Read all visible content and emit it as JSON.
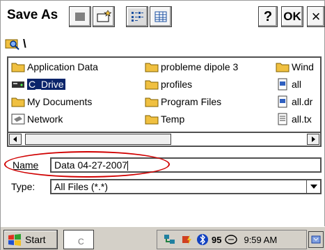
{
  "title": "Save As",
  "toolbar": {
    "help_label": "?",
    "ok_label": "OK",
    "close_label": "×"
  },
  "path": "\\",
  "files": [
    {
      "name": "Application Data",
      "icon": "folder-icon"
    },
    {
      "name": "C_Drive",
      "icon": "drive-icon",
      "selected": true
    },
    {
      "name": "My Documents",
      "icon": "folder-icon"
    },
    {
      "name": "Network",
      "icon": "network-icon"
    },
    {
      "name": "probleme dipole 3",
      "icon": "folder-icon"
    },
    {
      "name": "profiles",
      "icon": "folder-icon"
    },
    {
      "name": "Program Files",
      "icon": "folder-icon"
    },
    {
      "name": "Temp",
      "icon": "folder-icon"
    },
    {
      "name": "Wind",
      "icon": "folder-icon"
    },
    {
      "name": "all",
      "icon": "file-icon"
    },
    {
      "name": "all.dr",
      "icon": "file-icon"
    },
    {
      "name": "all.tx",
      "icon": "text-file-icon"
    }
  ],
  "name_field": {
    "label": "Name",
    "value": "Data 04-27-2007"
  },
  "type_field": {
    "label": "Type:",
    "value": "All Files (*.*)"
  },
  "taskbar": {
    "start_label": "Start",
    "task_label": "C",
    "tray_number": "95",
    "time": "9:59 AM"
  },
  "colors": {
    "selection": "#0a246a",
    "annotation": "#d00000",
    "folder": "#f0c040"
  }
}
